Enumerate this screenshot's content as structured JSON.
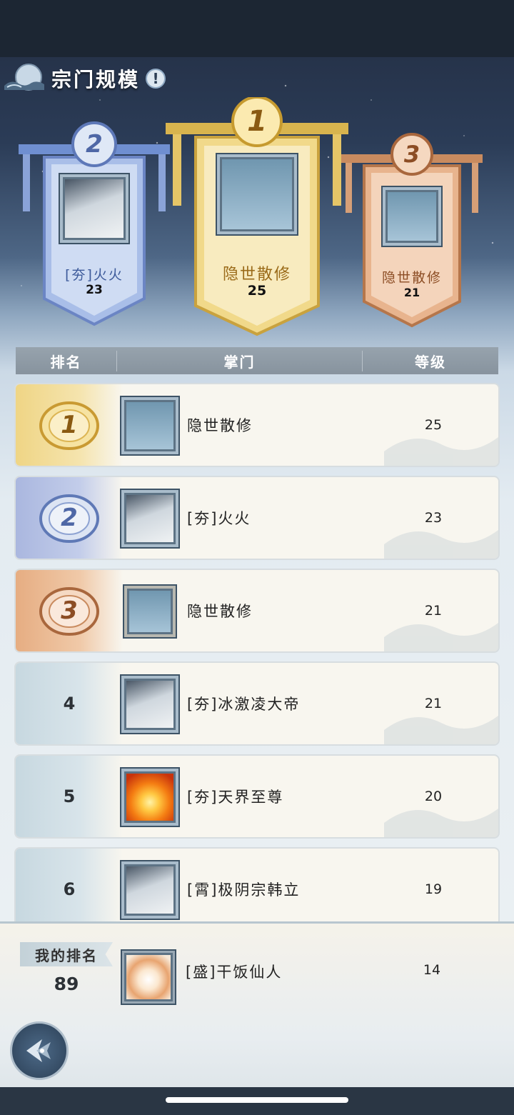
{
  "header": {
    "title": "宗门规模",
    "info_label": "!"
  },
  "podium": {
    "first": {
      "rank": "1",
      "name": "隐世散修",
      "level": "25"
    },
    "second": {
      "rank": "2",
      "name": "[夯]火火",
      "level": "23"
    },
    "third": {
      "rank": "3",
      "name": "隐世散修",
      "level": "21"
    }
  },
  "table": {
    "columns": [
      "排名",
      "掌门",
      "等级"
    ],
    "rows": [
      {
        "rank": "1",
        "name": "隐世散修",
        "level": "25",
        "avatar": "blank"
      },
      {
        "rank": "2",
        "name": "[夯]火火",
        "level": "23",
        "avatar": "character"
      },
      {
        "rank": "3",
        "name": "隐世散修",
        "level": "21",
        "avatar": "blank"
      },
      {
        "rank": "4",
        "name": "[夯]冰激凌大帝",
        "level": "21",
        "avatar": "character"
      },
      {
        "rank": "5",
        "name": "[夯]天界至尊",
        "level": "20",
        "avatar": "sunset"
      },
      {
        "rank": "6",
        "name": "[霄]极阴宗韩立",
        "level": "19",
        "avatar": "character"
      }
    ]
  },
  "my_rank": {
    "label": "我的排名",
    "rank": "89",
    "name": "[盛]干饭仙人",
    "level": "14",
    "avatar": "rice-bowl"
  },
  "colors": {
    "gold": "#f0cf72",
    "silver_blue": "#9fb3e0",
    "bronze": "#e3a47a"
  },
  "icons": {
    "back": "back-arrow-icon",
    "info": "info-icon"
  }
}
